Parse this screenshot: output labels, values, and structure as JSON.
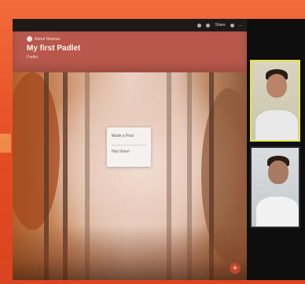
{
  "padlet": {
    "author": "Rahul Sharma",
    "title": "My first Padlet",
    "subtitle": "Padlet"
  },
  "browser": {
    "share_label": "Share",
    "more_label": "..."
  },
  "post": {
    "line1": "Made a Post",
    "line2": "Hey there!"
  },
  "add_button": "+",
  "participants": [
    {
      "name": ""
    },
    {
      "name": ""
    }
  ],
  "colors": {
    "bezel": "#e8542c",
    "header": "#b7584a",
    "active_speaker_border": "#e6e04a"
  }
}
